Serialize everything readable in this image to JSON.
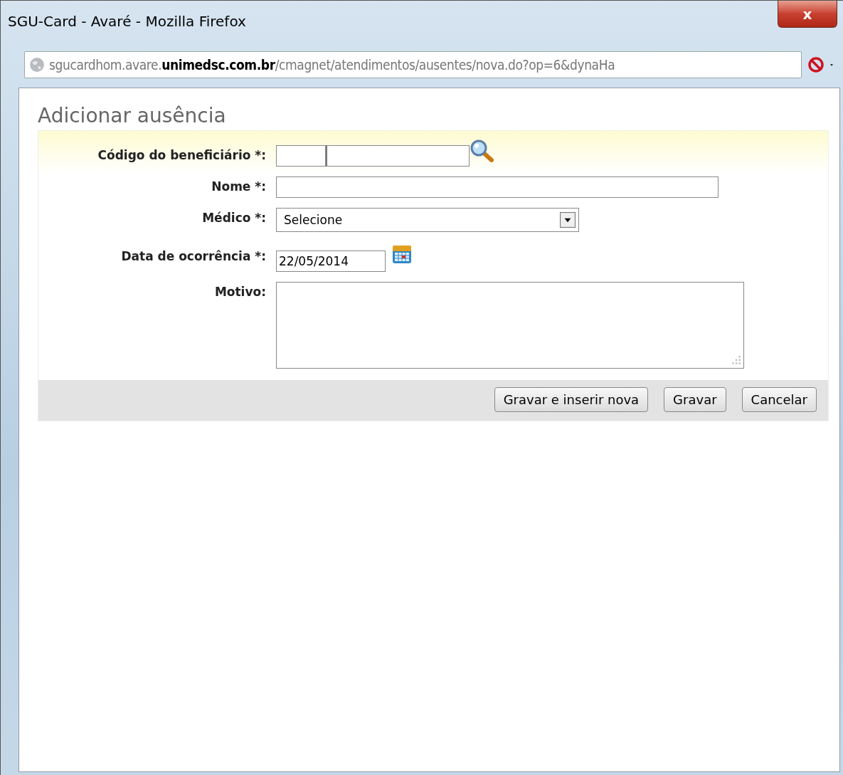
{
  "window": {
    "title": "SGU-Card - Avaré - Mozilla Firefox",
    "close": "x"
  },
  "address_bar": {
    "url": "sgucardhom.avare.**unimedsc.com.br**/cmagnet/atendimentos/ausentes/nova.do?op=6&dynaHa"
  },
  "form": {
    "title": "Adicionar ausência",
    "fields": [
      {
        "kind": "code",
        "label": "Código do beneficiário *:"
      },
      {
        "kind": "text",
        "label": "Nome *:"
      },
      {
        "kind": "select",
        "label": "Médico *:",
        "value": "Selecione"
      },
      {
        "kind": "date",
        "label": "Data de ocorrência *:",
        "value": "22/05/2014"
      },
      {
        "kind": "textarea",
        "label": "Motivo:"
      }
    ],
    "buttons": [
      "Gravar e inserir nova",
      "Gravar",
      "Cancelar"
    ]
  }
}
